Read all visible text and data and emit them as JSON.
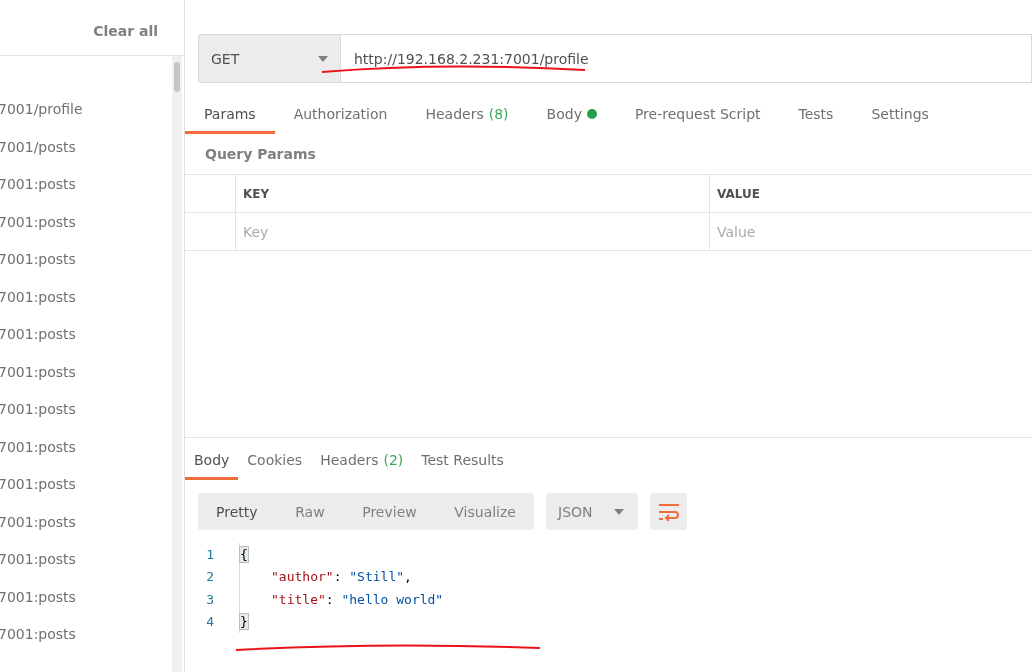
{
  "sidebar": {
    "clear_label": "Clear all",
    "history": [
      "7001/profile",
      "7001/posts",
      "7001:posts",
      "7001:posts",
      "7001:posts",
      "7001:posts",
      "7001:posts",
      "7001:posts",
      "7001:posts",
      "7001:posts",
      "7001:posts",
      "7001:posts",
      "7001:posts",
      "7001:posts",
      "7001:posts"
    ]
  },
  "request": {
    "method": "GET",
    "url": "http://192.168.2.231:7001/profile",
    "tabs": [
      {
        "label": "Params",
        "selected": true
      },
      {
        "label": "Authorization",
        "selected": false
      },
      {
        "label": "Headers",
        "count": "(8)",
        "selected": false
      },
      {
        "label": "Body",
        "dot": true,
        "selected": false
      },
      {
        "label": "Pre-request Script",
        "selected": false
      },
      {
        "label": "Tests",
        "selected": false
      },
      {
        "label": "Settings",
        "selected": false
      }
    ],
    "params_title": "Query Params",
    "table": {
      "columns": [
        "KEY",
        "VALUE"
      ],
      "placeholders": [
        "Key",
        "Value"
      ]
    }
  },
  "response": {
    "tabs": [
      {
        "label": "Body",
        "selected": true
      },
      {
        "label": "Cookies",
        "selected": false
      },
      {
        "label": "Headers",
        "count": "(2)",
        "selected": false
      },
      {
        "label": "Test Results",
        "selected": false
      }
    ],
    "views": [
      {
        "label": "Pretty",
        "selected": true
      },
      {
        "label": "Raw",
        "selected": false
      },
      {
        "label": "Preview",
        "selected": false
      },
      {
        "label": "Visualize",
        "selected": false
      }
    ],
    "format": "JSON",
    "lines": [
      {
        "number": "1",
        "tokens": [
          {
            "kind": "bracket",
            "text": "{"
          }
        ]
      },
      {
        "number": "2",
        "indented": true,
        "tokens": [
          {
            "kind": "key",
            "text": "\"author\""
          },
          {
            "kind": "punct",
            "text": ": "
          },
          {
            "kind": "string",
            "text": "\"Still\""
          },
          {
            "kind": "punct",
            "text": ","
          }
        ]
      },
      {
        "number": "3",
        "indented": true,
        "tokens": [
          {
            "kind": "key",
            "text": "\"title\""
          },
          {
            "kind": "punct",
            "text": ": "
          },
          {
            "kind": "string",
            "text": "\"hello world\""
          }
        ]
      },
      {
        "number": "4",
        "tokens": [
          {
            "kind": "bracket",
            "text": "}"
          }
        ]
      }
    ]
  }
}
